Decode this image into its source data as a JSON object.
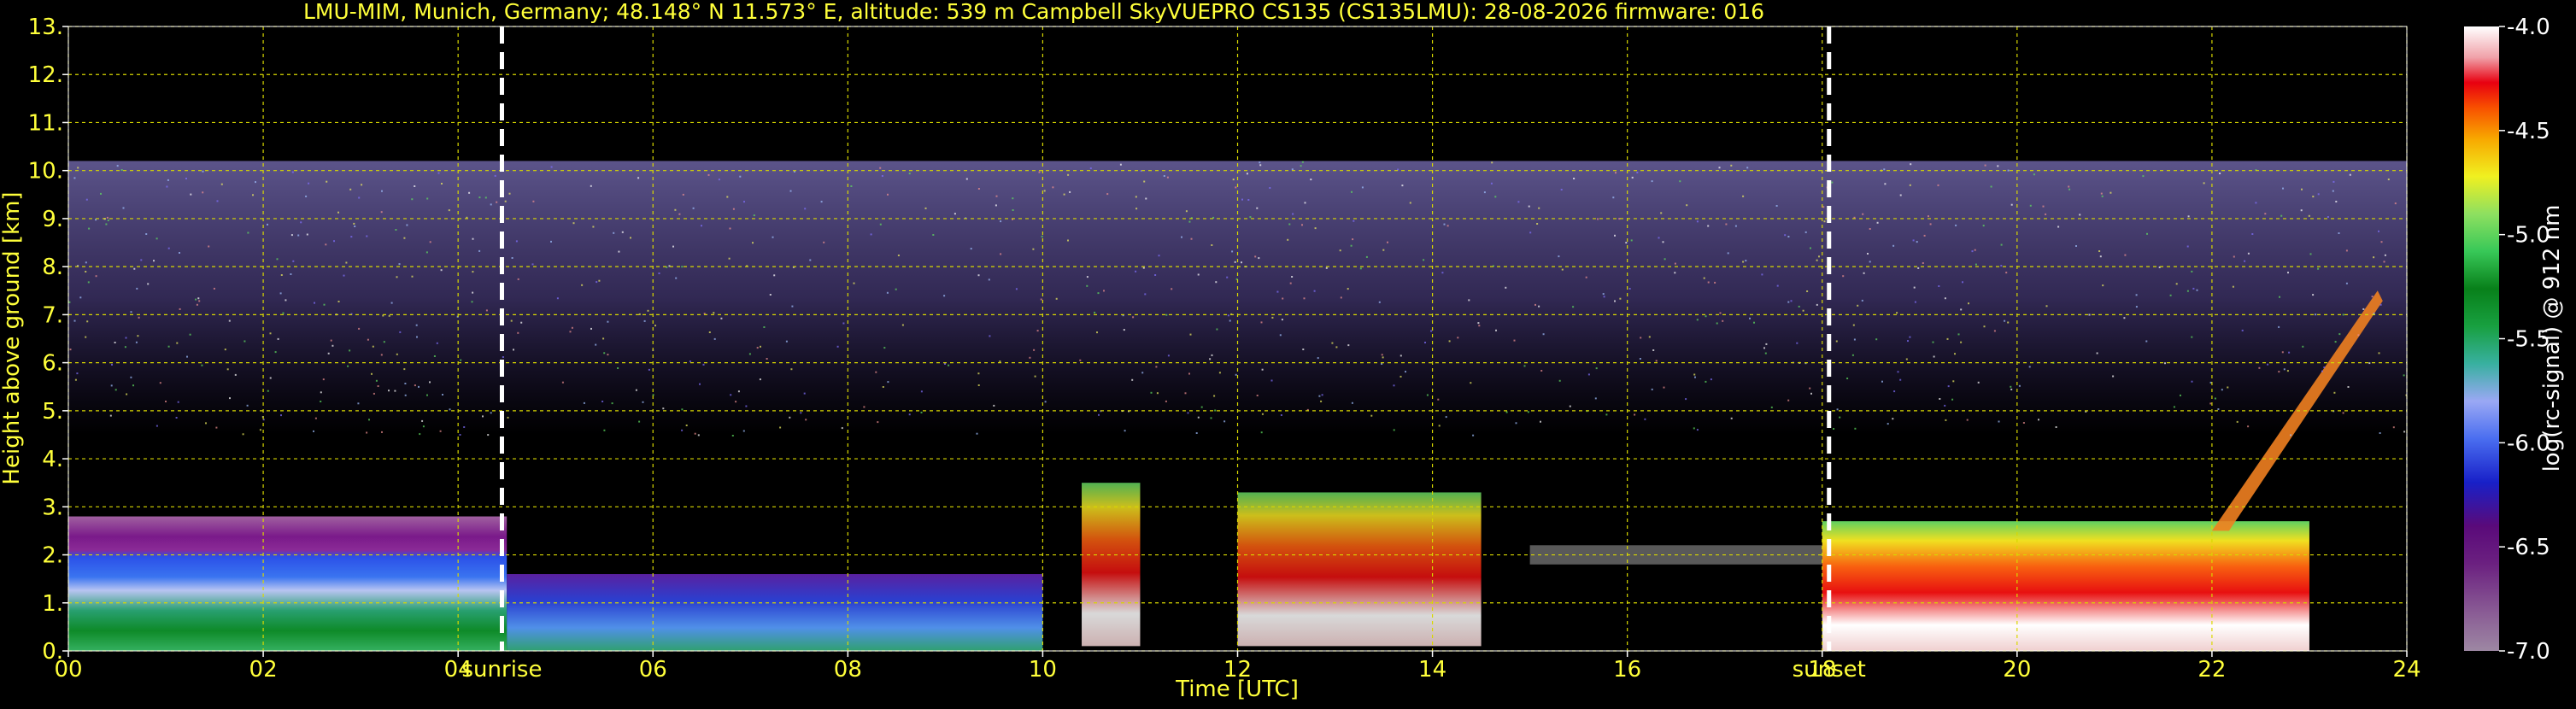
{
  "chart_data": {
    "type": "heatmap",
    "title": "LMU-MIM, Munich, Germany; 48.148° N 11.573° E, altitude: 539 m    Campbell SkyVUEPRO CS135 (CS135LMU): 28-08-2026    firmware: 016",
    "xlabel": "Time [UTC]",
    "ylabel": "Height above ground [km]",
    "xlim": [
      0,
      24
    ],
    "ylim": [
      0,
      13
    ],
    "x_ticks": [
      "00",
      "02",
      "04",
      "06",
      "08",
      "10",
      "12",
      "14",
      "16",
      "18",
      "20",
      "22",
      "24"
    ],
    "y_ticks": [
      "0.",
      "1.",
      "2.",
      "3.",
      "4.",
      "5.",
      "6.",
      "7.",
      "8.",
      "9.",
      "10.",
      "11.",
      "12.",
      "13."
    ],
    "grid": true,
    "markers": [
      {
        "label": "sunrise",
        "x": 4.45
      },
      {
        "label": "sunset",
        "x": 18.07
      }
    ],
    "colorbar": {
      "label": "log(rc-signal) @ 912 nm",
      "range": [
        -7.0,
        -4.0
      ],
      "ticks": [
        "-4.0",
        "-4.5",
        "-5.0",
        "-5.5",
        "-6.0",
        "-6.5",
        "-7.0"
      ]
    },
    "layers": [
      {
        "feature": "noisy signal top",
        "x": [
          0,
          24
        ],
        "y": [
          4.5,
          10.2
        ]
      },
      {
        "feature": "boundary layer aerosol",
        "x": [
          0,
          4.5
        ],
        "y": [
          0.0,
          2.8
        ]
      },
      {
        "feature": "boundary layer aerosol",
        "x": [
          4.5,
          10.0
        ],
        "y": [
          0.0,
          1.6
        ]
      },
      {
        "feature": "convective cloud",
        "x": [
          10.4,
          11.0
        ],
        "y": [
          0.1,
          3.5
        ]
      },
      {
        "feature": "convective cloud",
        "x": [
          12.0,
          14.5
        ],
        "y": [
          0.1,
          3.3
        ]
      },
      {
        "feature": "cloud base layer",
        "x": [
          15.0,
          18.0
        ],
        "y": [
          1.8,
          2.2
        ]
      },
      {
        "feature": "dense cloud",
        "x": [
          18.0,
          23.0
        ],
        "y": [
          0.0,
          2.7
        ]
      },
      {
        "feature": "rising layer",
        "x": [
          22.0,
          23.7
        ],
        "y": [
          2.5,
          7.5
        ]
      }
    ]
  }
}
